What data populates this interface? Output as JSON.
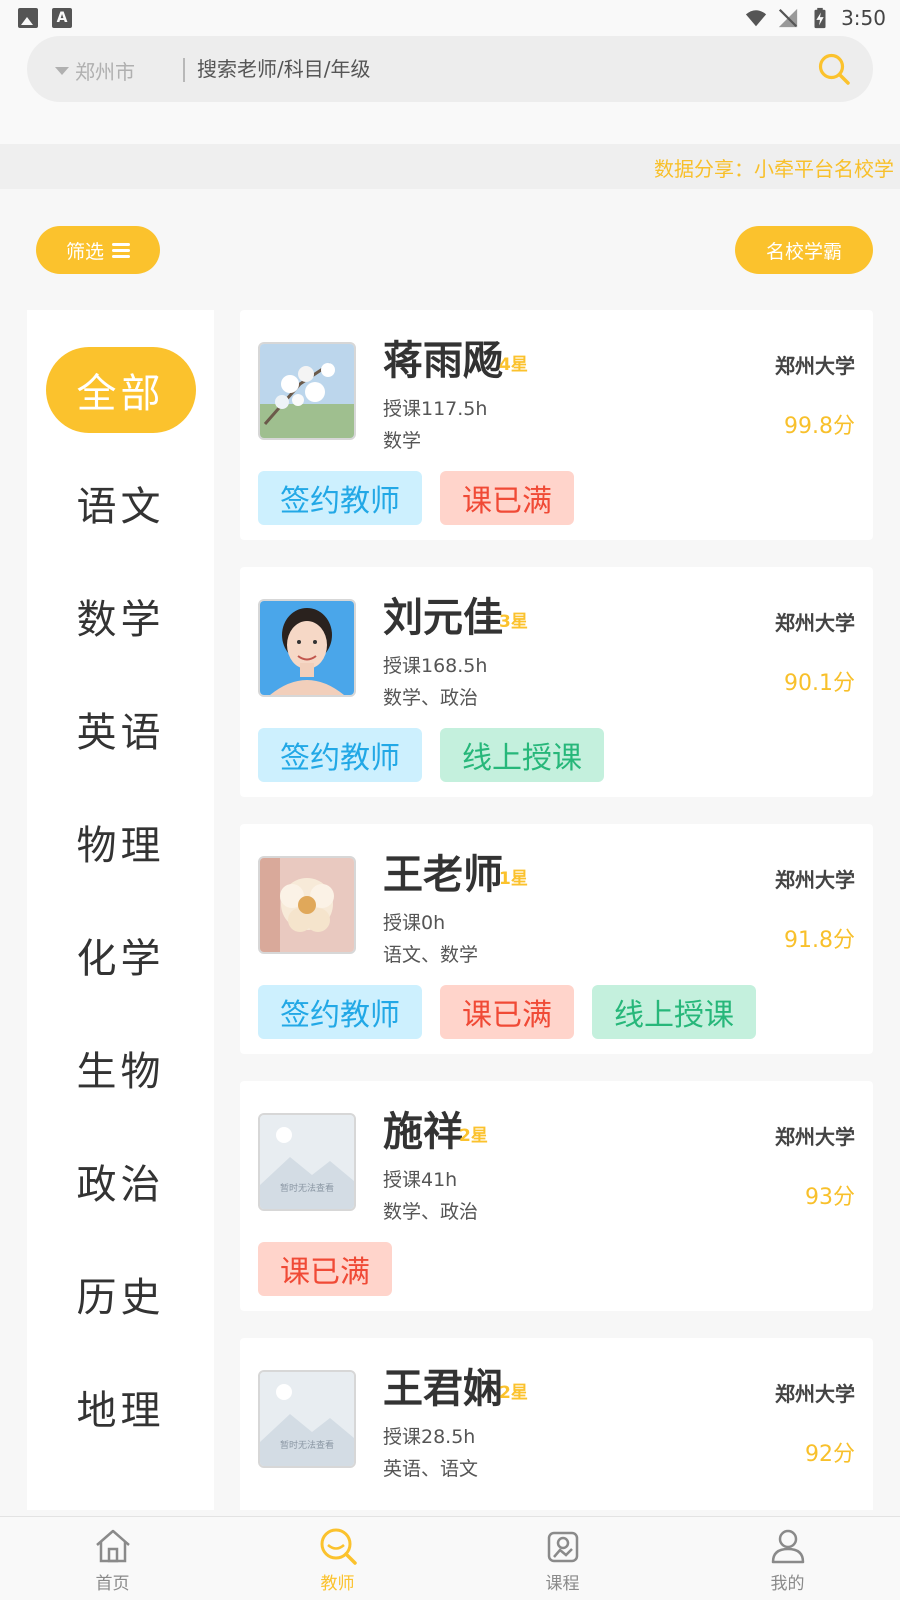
{
  "status_bar": {
    "time": "3:50"
  },
  "search": {
    "city": "郑州市",
    "placeholder": "搜索老师/科目/年级"
  },
  "marquee": {
    "text": "数据分享：小牵平台名校学"
  },
  "filter": {
    "filter_label": "筛选",
    "school_label": "名校学霸"
  },
  "sidebar": {
    "subjects": [
      {
        "label": "全部",
        "active": true
      },
      {
        "label": "语文"
      },
      {
        "label": "数学"
      },
      {
        "label": "英语"
      },
      {
        "label": "物理"
      },
      {
        "label": "化学"
      },
      {
        "label": "生物"
      },
      {
        "label": "政治"
      },
      {
        "label": "历史"
      },
      {
        "label": "地理"
      }
    ]
  },
  "teachers": [
    {
      "name": "蒋雨飏",
      "stars": "4星",
      "hours": "授课117.5h",
      "subjects": "数学",
      "university": "郑州大学",
      "score": "99.8分",
      "avatar": "flower-photo",
      "tags": [
        {
          "label": "签约教师",
          "kind": "sign"
        },
        {
          "label": "课已满",
          "kind": "full"
        }
      ]
    },
    {
      "name": "刘元佳",
      "stars": "3星",
      "hours": "授课168.5h",
      "subjects": "数学、政治",
      "university": "郑州大学",
      "score": "90.1分",
      "avatar": "portrait-photo",
      "tags": [
        {
          "label": "签约教师",
          "kind": "sign"
        },
        {
          "label": "线上授课",
          "kind": "online"
        }
      ]
    },
    {
      "name": "王老师",
      "stars": "1星",
      "hours": "授课0h",
      "subjects": "语文、数学",
      "university": "郑州大学",
      "score": "91.8分",
      "avatar": "flower-close-photo",
      "tags": [
        {
          "label": "签约教师",
          "kind": "sign"
        },
        {
          "label": "课已满",
          "kind": "full"
        },
        {
          "label": "线上授课",
          "kind": "online"
        }
      ]
    },
    {
      "name": "施祥",
      "stars": "2星",
      "hours": "授课41h",
      "subjects": "数学、政治",
      "university": "郑州大学",
      "score": "93分",
      "avatar": "placeholder",
      "avatar_text": "暂时无法查看",
      "tags": [
        {
          "label": "课已满",
          "kind": "full"
        }
      ]
    },
    {
      "name": "王君娴",
      "stars": "2星",
      "hours": "授课28.5h",
      "subjects": "英语、语文",
      "university": "郑州大学",
      "score": "92分",
      "avatar": "placeholder",
      "avatar_text": "暂时无法查看",
      "tags": []
    }
  ],
  "bottom_nav": [
    {
      "label": "首页",
      "icon": "home-icon"
    },
    {
      "label": "教师",
      "icon": "teacher-search-icon",
      "active": true
    },
    {
      "label": "课程",
      "icon": "course-icon"
    },
    {
      "label": "我的",
      "icon": "profile-icon"
    }
  ],
  "colors": {
    "accent": "#fbc22d",
    "sign_bg": "#cdf0fe",
    "full_bg": "#ffd4cb",
    "online_bg": "#c4f0dd"
  }
}
